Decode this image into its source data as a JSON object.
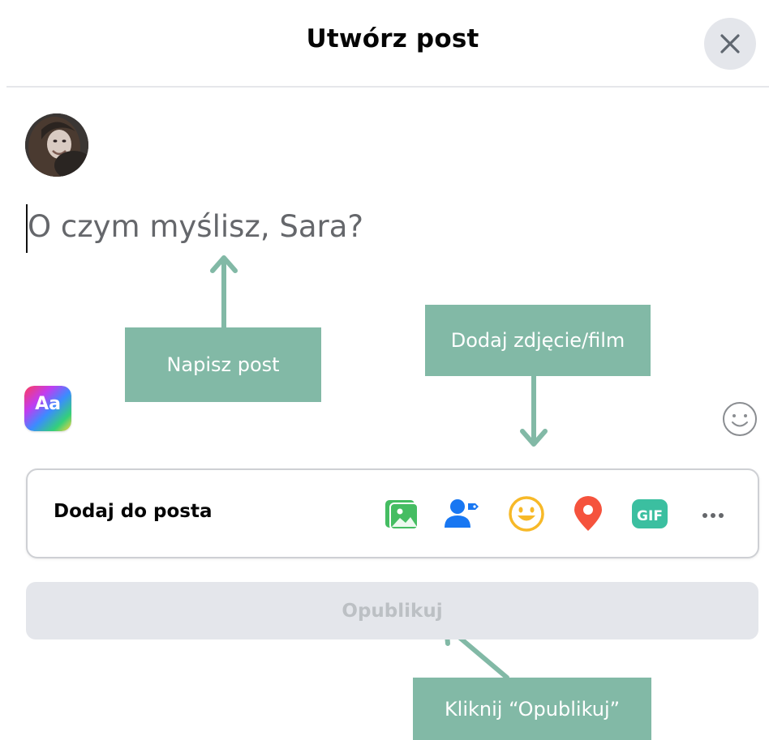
{
  "dialog": {
    "title": "Utwórz post",
    "close_icon": "close-icon"
  },
  "composer": {
    "avatar": "user-avatar",
    "placeholder": "O czym myślisz, Sara?"
  },
  "format": {
    "background_button_label": "Aa",
    "emoji_icon": "smiley-outline-icon"
  },
  "add_to_post": {
    "label": "Dodaj do posta",
    "tools": [
      {
        "icon": "photo-video-icon",
        "color": "#45bd62"
      },
      {
        "icon": "tag-people-icon",
        "color": "#1877f2"
      },
      {
        "icon": "feeling-icon",
        "color": "#f7b928"
      },
      {
        "icon": "check-in-icon",
        "color": "#f5533d"
      },
      {
        "icon": "gif-icon",
        "color": "#3bbfa0"
      },
      {
        "icon": "more-icon",
        "color": "#65676b"
      }
    ]
  },
  "publish": {
    "label": "Opublikuj"
  },
  "annotations": {
    "write_post": "Napisz post",
    "add_media": "Dodaj zdjęcie/film",
    "click_publish": "Kliknij “Opublikuj”",
    "color": "#82b9a6"
  }
}
